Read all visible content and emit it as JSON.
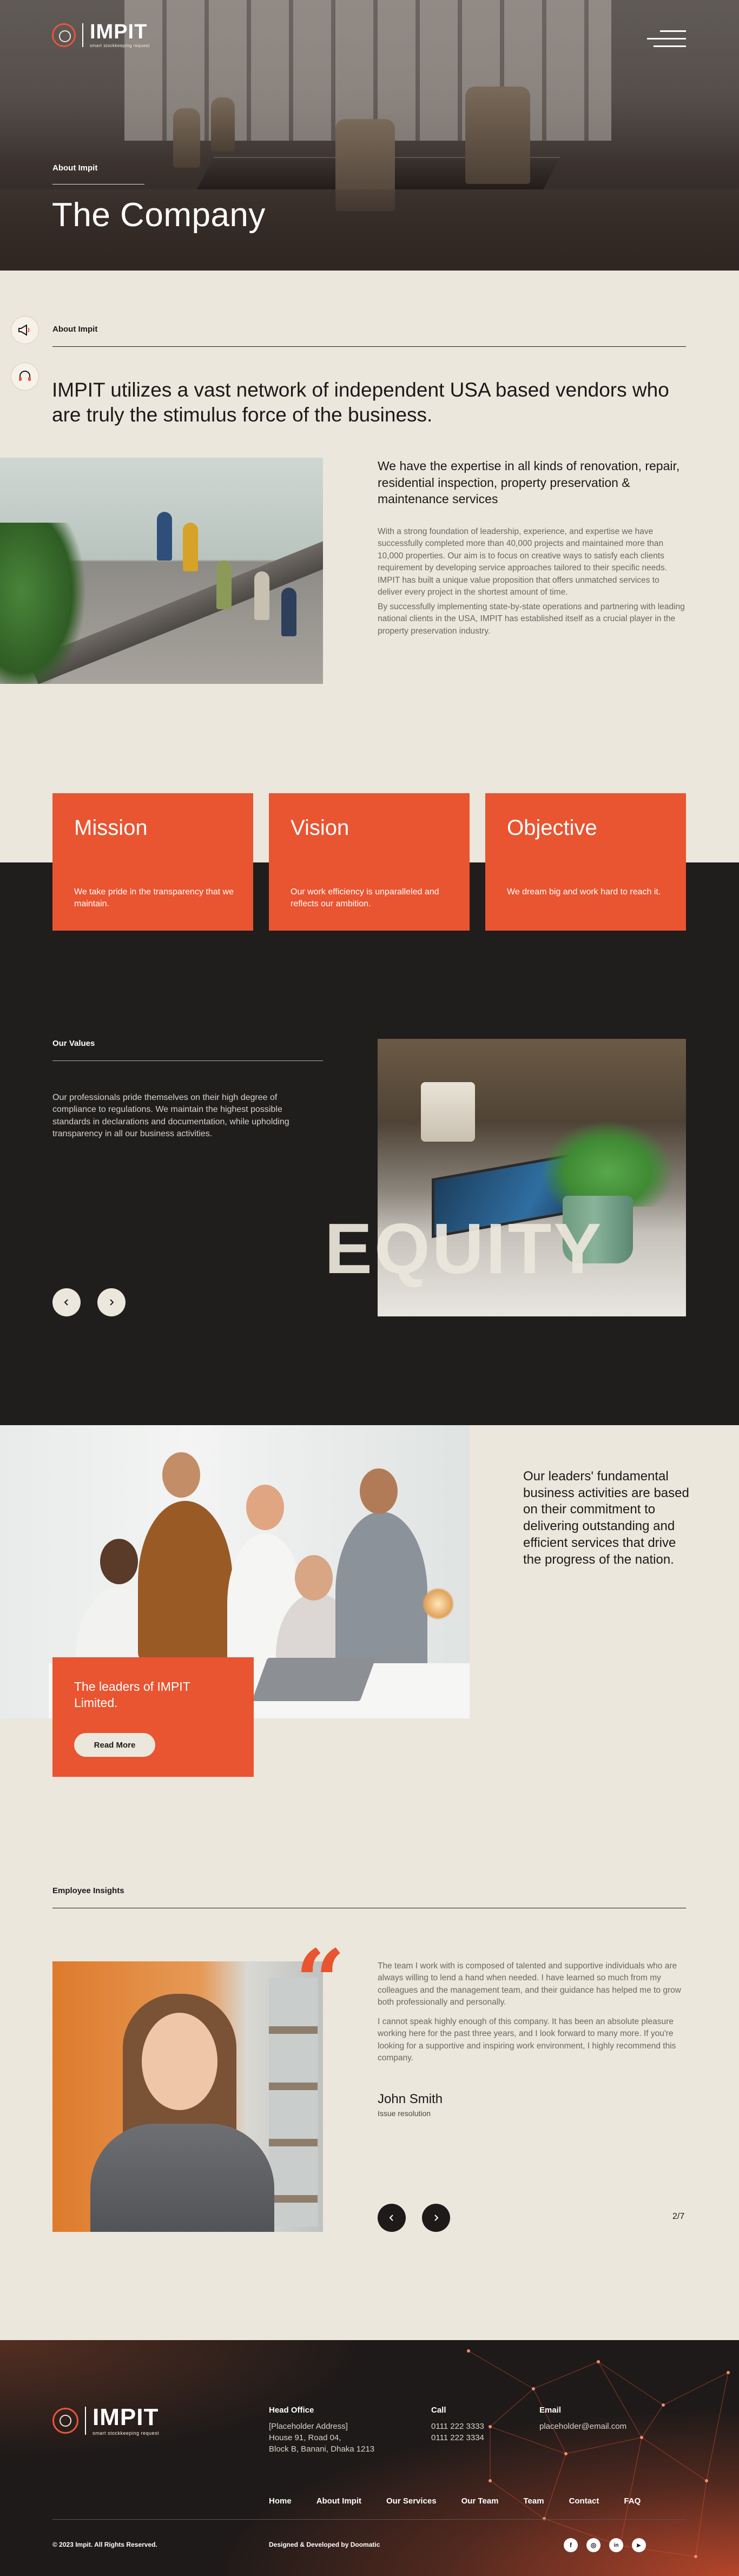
{
  "brand": {
    "name": "IMPIT",
    "tagline": "smart stockkeeping request",
    "accent": "#e95431",
    "dark": "#201d1d",
    "cream": "#ece7dc"
  },
  "hero": {
    "eyebrow": "About Impit",
    "title": "The Company",
    "menu_icon": "hamburger-icon"
  },
  "about": {
    "label": "About Impit",
    "heading": "IMPIT utilizes a vast network of independent USA based vendors who are truly the stimulus force of the business.",
    "expertise_title": "We have the expertise in all kinds of renovation, repair, residential inspection, property preservation & maintenance services",
    "p1": "With a strong foundation of leadership, experience, and expertise we have successfully completed more than 40,000 projects and maintained more than 10,000 properties. Our aim is to focus on creative ways to satisfy each clients requirement by developing service approaches tailored to their specific needs. IMPIT has built a unique value proposition that offers unmatched services to deliver every project in the shortest amount of time.",
    "p2": "By successfully implementing state-by-state operations and partnering with leading national clients in the USA, IMPIT has established itself as a crucial player in the property preservation industry."
  },
  "side_icons": [
    {
      "icon": "megaphone-icon"
    },
    {
      "icon": "headset-icon"
    }
  ],
  "mvo": [
    {
      "title": "Mission",
      "desc": "We take pride in the transparency that we maintain."
    },
    {
      "title": "Vision",
      "desc": "Our work efficiency is unparalleled and reflects our ambition."
    },
    {
      "title": "Objective",
      "desc": "We dream big and work hard to reach it."
    }
  ],
  "values": {
    "label": "Our Values",
    "text": "Our professionals pride themselves on their high degree of compliance to regulations. We maintain the highest possible standards in declarations and documentation, while upholding transparency in all our business activities.",
    "overlay": "EQUITY"
  },
  "leaders": {
    "card_title": "The leaders of IMPIT Limited.",
    "button": "Read More",
    "quote": "Our leaders' fundamental business activities are based on their commitment to delivering outstanding and efficient services that drive the progress of the nation."
  },
  "insights": {
    "label": "Employee Insights",
    "p1": "The team I work with is composed of talented and supportive individuals who are always willing to lend a hand when needed. I have learned so much from my colleagues and the management team, and their guidance has helped me to grow both professionally and personally.",
    "p2": "I cannot speak highly enough of this company. It has been an absolute pleasure working here for the past three years, and I look forward to many more. If you're looking for a supportive and inspiring work environment, I highly recommend this company.",
    "name": "John Smith",
    "role": "Issue resolution",
    "counter": "2/7",
    "quote_glyph": "“"
  },
  "footer": {
    "head_office_h": "Head Office",
    "address": [
      "[Placeholder Address]",
      "House 91, Road 04,",
      "Block B, Banani, Dhaka 1213"
    ],
    "call_h": "Call",
    "phones": [
      "0111 222 3333",
      "0111 222 3334"
    ],
    "email_h": "Email",
    "email": "placeholder@email.com",
    "nav": [
      "Home",
      "About Impit",
      "Our Services",
      "Our Team",
      "Team",
      "Contact",
      "FAQ"
    ],
    "copyright": "© 2023 Impit. All Rights Reserved.",
    "developer": "Designed & Developed by Doomatic",
    "social": [
      {
        "icon": "facebook-icon",
        "glyph": "f"
      },
      {
        "icon": "instagram-icon",
        "glyph": "◎"
      },
      {
        "icon": "linkedin-icon",
        "glyph": "in"
      },
      {
        "icon": "youtube-icon",
        "glyph": "▶"
      }
    ]
  }
}
